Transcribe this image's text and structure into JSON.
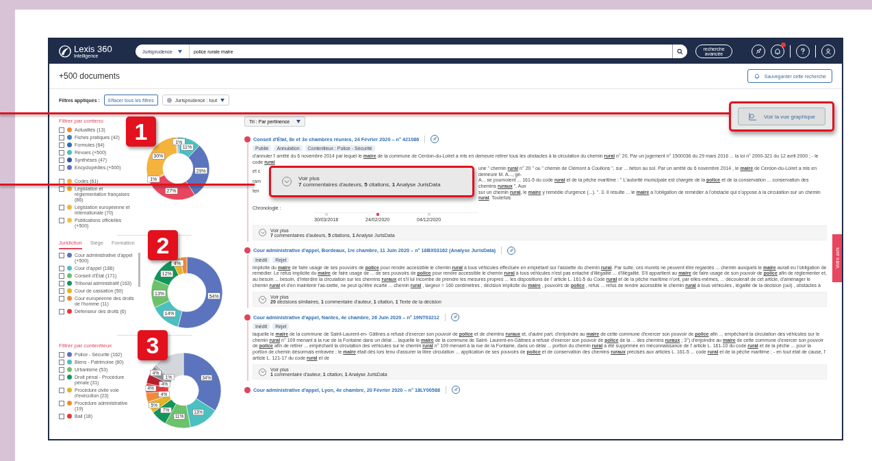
{
  "header": {
    "logo": "Lexis 360",
    "logo_sub": "Intelligence",
    "scope": "Jurisprudence",
    "query": "police rurale maire",
    "advanced": "recherche avancée",
    "notifications_unread": true
  },
  "results_count": "+500 documents",
  "save_search": "Sauvegarder cette recherche",
  "filters": {
    "label": "Filtres appliqués :",
    "clear": "Effacer tous les filtres",
    "chip": "Jurisprudence : tout"
  },
  "graph_view": "Voir la vue graphique",
  "sort": "Tri : Par pertinence",
  "content_filter": {
    "title": "Filtrer par contenu",
    "items": [
      {
        "label": "Actualités (13)",
        "color": "#f08a34",
        "checked": false
      },
      {
        "label": "Fiches pratiques (42)",
        "color": "#3a7fc4",
        "checked": false
      },
      {
        "label": "Formules (64)",
        "color": "#2f6db5",
        "checked": false
      },
      {
        "label": "Revues (+500)",
        "color": "#4cbfc0",
        "checked": false
      },
      {
        "label": "Synthèses (47)",
        "color": "#33539e",
        "checked": false
      },
      {
        "label": "Encyclopédies (+500)",
        "color": "#5b74bd",
        "checked": false
      },
      {
        "label": "Codes (61)",
        "color": "#f5b23c",
        "checked": false
      },
      {
        "label": "Législation et réglementation françaises (86)",
        "color": "#e9a92e",
        "checked": false
      },
      {
        "label": "Législation européenne et internationale (70)",
        "color": "#f0b640",
        "checked": false
      },
      {
        "label": "Publications officielles (+500)",
        "color": "#f5c04a",
        "checked": false
      }
    ],
    "chart_data": {
      "type": "donut",
      "values": [
        1,
        11,
        29,
        27,
        1,
        30,
        1
      ],
      "colors": [
        "#3a7fc4",
        "#4cbfc0",
        "#5b74bd",
        "#e8465e",
        "#f5c04a",
        "#f5b23c",
        "#f7d27a"
      ],
      "data_labels": true,
      "value_labels": [
        "1%",
        "11%",
        "29%",
        "27%",
        "1%",
        "30%",
        null
      ]
    }
  },
  "jurisdiction_filter": {
    "tabs": [
      {
        "label": "Juridiction",
        "selected": true
      },
      {
        "label": "Siège",
        "selected": false
      },
      {
        "label": "Formation",
        "selected": false
      }
    ],
    "items": [
      {
        "label": "Cour administrative d'appel (+500)",
        "color": "#5b74bd",
        "checked": false
      },
      {
        "label": "Cour d'appel (186)",
        "color": "#4cbfc0",
        "checked": false
      },
      {
        "label": "Conseil d'État (171)",
        "color": "#6cc26a",
        "checked": false
      },
      {
        "label": "Tribunal administratif (163)",
        "color": "#13955a",
        "checked": false
      },
      {
        "label": "Cour de cassation (50)",
        "color": "#e6b324",
        "checked": false
      },
      {
        "label": "Cour européenne des droits de l'homme (11)",
        "color": "#f08a34",
        "checked": false
      },
      {
        "label": "Défenseur des droits (6)",
        "color": "#e5383b",
        "checked": false
      }
    ],
    "chart_data": {
      "type": "donut",
      "values": [
        54,
        14,
        13,
        12,
        4,
        3
      ],
      "colors": [
        "#5b74bd",
        "#4cbfc0",
        "#6cc26a",
        "#13955a",
        "#e6b324",
        "#f08a34"
      ],
      "data_labels": true,
      "value_labels": [
        "54%",
        "14%",
        "13%",
        "12%",
        "4%",
        null
      ]
    }
  },
  "litigation_filter": {
    "title": "Filtrer par contentieux",
    "items": [
      {
        "label": "Police - Sécurité (162)",
        "color": "#5b74bd",
        "checked": false
      },
      {
        "label": "Biens - Patrimoine (60)",
        "color": "#4cbfc0",
        "checked": false
      },
      {
        "label": "Urbanisme (53)",
        "color": "#6cc26a",
        "checked": false
      },
      {
        "label": "Droit pénal - Procédure pénale (31)",
        "color": "#13955a",
        "checked": false
      },
      {
        "label": "Procédure civile voie d'exécution (23)",
        "color": "#e6b324",
        "checked": false
      },
      {
        "label": "Procédure administrative (19)",
        "color": "#f08a34",
        "checked": false
      },
      {
        "label": "Bail (18)",
        "color": "#e5383b",
        "checked": false
      }
    ],
    "chart_data": {
      "type": "donut",
      "values": [
        34,
        13,
        11,
        7,
        5,
        4,
        4,
        4,
        4,
        1,
        13
      ],
      "colors": [
        "#5b74bd",
        "#4cbfc0",
        "#6cc26a",
        "#13955a",
        "#e6b324",
        "#f08a34",
        "#e5383b",
        "#b5202b",
        "#8a8f96",
        "#b0b4b8",
        "#d3d6da"
      ],
      "data_labels": true,
      "value_labels": [
        "34%",
        "13%",
        "11%",
        "7%",
        "5%",
        "4%",
        "4%",
        "4%",
        "4%",
        "1%",
        null
      ]
    }
  },
  "documents": [
    {
      "title": "Conseil d'État, 8e et 3e chambres réunies, 24 Février 2020 – n° 421086",
      "tags": [
        "Publié",
        "Annulation",
        "Contentieux : Police - Sécurité"
      ],
      "snippet": "d'annuler l' arrêté du 6 novembre 2014 par lequel le **maire** de la commune de Cerdon-du-Loiret a mis en demeure retirer tous les obstacles à la circulation du chemin **rural** n° 20. Par un jugement n° 1500036 du 29 mars 2016 ... la loi n° 2000-321 du 12 avril 2000 ; - le code **rural**",
      "covered_lines": [
        {
          "left": "et c",
          "text": "une \" chemin **rural** n° 20 \" ou \" chemin de Clémont à Coullons \", sur ... béton au sol. Par un arrêté du 6 novembre 2014 , le **maire** de Cerdon-du-Loiret a mis en demeure M. A..., gé-"
        },
        {
          "left": "ram",
          "text": "A... se pourvoient ... 161-5 du code **rural** et de la pêche maritime : \" L'autorité municipale est chargée de la **police** et de la conservation ... conservation des chemins **ruraux** \". Aux"
        },
        {
          "left": "ten",
          "text": "sur un chemin **rural**, le **maire** y remédie d'urgence (...). \". 3. Il résulte ... le **maire** a l'obligation de remédier à l'obstacle qui s'oppose à la circulation sur un chemin **rural**. Toutefois"
        }
      ],
      "chronology": {
        "label": "Chronologie :",
        "dates": [
          {
            "label": "30/03/2018",
            "selected": false
          },
          {
            "label": "24/02/2020",
            "selected": true
          },
          {
            "label": "04/12/2020",
            "selected": false
          }
        ]
      },
      "more": {
        "label": "Voir plus",
        "summary": "**7** commentaires d'auteurs, **5** citations, **1** Analyse JurisData"
      }
    },
    {
      "title": "Cour administrative d'appel, Bordeaux, 1re chambre, 11 Juin 2020 – n° 18BX03162 (Analyse JurisData)",
      "tags": [
        "Inédit",
        "Rejet"
      ],
      "snippet": "implicite du **maire** de faire usage de ses pouvoirs de **police** pour rendre accessible le chemin **rural** à tous véhicules effectuée en empiétant sur l'assiette du chemin **rural**. Par suite, ces murets ne peuvent être regardés ... chemin auxquels le **maire** aurait eu l'obligation de remédier. Le refus implicite du **maire** de faire usage de ... de ses pouvoirs de **police** pour rendre accessible le chemin **rural** à tous véhicules n'est pas entaché d'illégalité ... d'illégalité. S'il appartient au **maire** de faire usage de son pouvoir de **police** afin de réglementer et, au besoin ... besoin, d'interdire la circulation sur les chemins **ruraux** et s'il lui incombe de prendre les mesures propres ... les dispositions de l' article L. 161-5 du Code **rural** et de la pêche maritime n'ont, par elles-mêmes, ... découlerait de cet article, d'aménager le chemin **rural** et d'en maintenir l'as-siette, ne peut qu'être écarté ... chemin **rural** , largeur = 160 centimètres , décision implicite du **maire** , pouvoirs de **police** , refus ... refus de rendre accessible le chemin **rural** à tous véhicules , légalité de la décision (oui) , obstacles à",
      "more": {
        "label": "Voir plus",
        "summary": "**20** décisions similaires, **1** commentaire d'auteur, **1** citation, **1** Texte de la décision"
      }
    },
    {
      "title": "Cour administrative d'appel, Nantes, 4e chambre, 26 Juin 2020 – n° 19NT03212",
      "tags": [
        "Inédit",
        "Rejet"
      ],
      "snippet": "laquelle le **maire** de la commune de Saint-Laurent-en- Gâtines a refusé d'exercer son pouvoir de **police** et de chemins **ruraux** et, d'autre part, d'enjoindre au **maire** de cette commune d'exercer son pouvoir de **police** afin ... empêchant la circulation des véhicules sur le chemin **rural** n° 109 menant à la rue de la Fontaine dans un délai ... laquelle le **maire** de la commune de Saint- Laurent-en-Gâtines a refusé d'exercer son pouvoir de **police** de la ... des chemins **ruraux** ; 3°) d'enjoindre au **maire** de cette commune d'exercer son pouvoir de **police** afin de retirer ... empêchant la circulation des véhicules sur le chemin **rural** n° 109 menant à la rue de la Fontaine, dans un délai ... portion du chemin **rural** a été supprimée en méconnaissance de l' article L. 161-10 du code **rural** et de la pêche ... pour la portion de chemin désormais entravée ; le **maire** était dès lors tenu d'assurer la libre circulation ... application de ses pouvoirs de **police** et de conservation des chemins **ruraux** précisés aux articles L. 161-5 ... code **rural** et de la pêche maritime ; - en tout état de cause, l' article L. 121-17 du code **rural** et de",
      "more": {
        "label": "Voir plus",
        "summary": "**1** commentaire d'auteur, **1** citation, **1** Analyse JurisData"
      }
    },
    {
      "title": "Cour administrative d'appel, Lyon, 4e chambre, 20 Février 2020 – n° 18LY00588"
    }
  ],
  "feedback_tab": "Votre avis",
  "callouts": [
    "1",
    "2",
    "3"
  ],
  "zoom_callout": {
    "label": "Voir plus",
    "summary": "**7** commentaires d'auteurs, **5** citations, **1** Analyse JurisData"
  }
}
